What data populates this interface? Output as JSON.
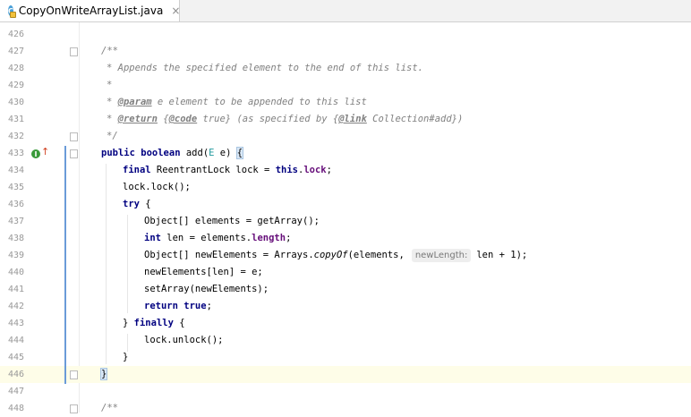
{
  "tab": {
    "title": "CopyOnWriteArrayList.java",
    "icon_letter": "C",
    "close_glyph": "×"
  },
  "gutter": {
    "line_numbers": [
      "426",
      "427",
      "428",
      "429",
      "430",
      "431",
      "432",
      "433",
      "434",
      "435",
      "436",
      "437",
      "438",
      "439",
      "440",
      "441",
      "442",
      "443",
      "444",
      "445",
      "446",
      "447",
      "448"
    ],
    "implements_icon_letter": "I",
    "override_arrow": "↑"
  },
  "code": {
    "l427": "/**",
    "l428": "* Appends the specified element to the end of this list.",
    "l429": "*",
    "l430_star": "* ",
    "l430_tag": "@param",
    "l430_rest": " e element to be appended to this list",
    "l431_star": "* ",
    "l431_tag": "@return",
    "l431_brace1": " {",
    "l431_code": "@code",
    "l431_mid": " true} (as specified by {",
    "l431_link": "@link",
    "l431_end": " Collection#add})",
    "l432": "*/",
    "l433_kw1": "public",
    "l433_kw2": "boolean",
    "l433_name": " add(",
    "l433_type": "E",
    "l433_param": " e) ",
    "l433_brace": "{",
    "l434_kw": "final",
    "l434_mid": " ReentrantLock lock = ",
    "l434_this": "this",
    "l434_dot": ".",
    "l434_field": "lock",
    "l434_end": ";",
    "l435": "lock.lock();",
    "l436_kw": "try",
    "l436_rest": " {",
    "l437": "Object[] elements = getArray();",
    "l438_kw": "int",
    "l438_mid": " len = elements.",
    "l438_field": "length",
    "l438_end": ";",
    "l439_start": "Object[] newElements = Arrays.",
    "l439_static": "copyOf",
    "l439_mid": "(elements,",
    "l439_hint": "newLength:",
    "l439_end": "len + 1);",
    "l440": "newElements[len] = e;",
    "l441": "setArray(newElements);",
    "l442_kw1": "return",
    "l442_kw2": "true",
    "l442_end": ";",
    "l443_start": "} ",
    "l443_kw": "finally",
    "l443_end": " {",
    "l444": "lock.unlock();",
    "l445": "}",
    "l446": "}",
    "l448": "/**"
  },
  "colors": {
    "keyword": "#000080",
    "comment": "#808080",
    "field": "#660e7a",
    "caret_row": "#fefde8",
    "change_bar": "#6a9bd8"
  }
}
